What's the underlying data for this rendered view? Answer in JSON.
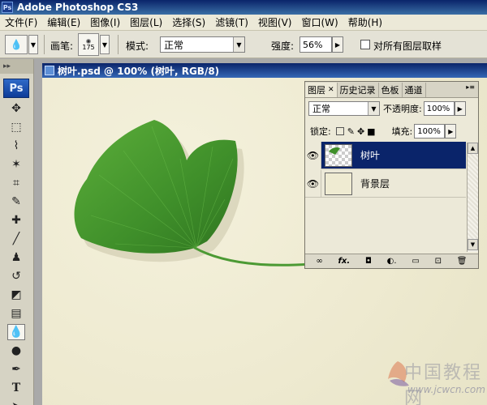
{
  "app": {
    "title": "Adobe Photoshop CS3",
    "logo": "Ps"
  },
  "menu": [
    "文件(F)",
    "编辑(E)",
    "图像(I)",
    "图层(L)",
    "选择(S)",
    "滤镜(T)",
    "视图(V)",
    "窗口(W)",
    "帮助(H)"
  ],
  "options": {
    "brush_label": "画笔:",
    "brush_size": "175",
    "mode_label": "模式:",
    "mode_value": "正常",
    "strength_label": "强度:",
    "strength_value": "56%",
    "sample_all_label": "对所有图层取样"
  },
  "tools": {
    "grip": "▸▸"
  },
  "document": {
    "title": "树叶.psd @ 100% (树叶, RGB/8)"
  },
  "layers_panel": {
    "tabs": [
      "图层",
      "历史记录",
      "色板",
      "通道"
    ],
    "blend_mode": "正常",
    "opacity_label": "不透明度:",
    "opacity_value": "100%",
    "lock_label": "锁定:",
    "fill_label": "填充:",
    "fill_value": "100%",
    "layers": [
      {
        "name": "树叶",
        "active": true
      },
      {
        "name": "背景层",
        "active": false
      }
    ],
    "bottom_icons": [
      "link-icon",
      "fx-icon",
      "mask-icon",
      "adjustment-icon",
      "group-icon",
      "new-layer-icon",
      "trash-icon"
    ],
    "bottom_labels": [
      "∞",
      "fx.",
      "◘",
      "◐.",
      "▭",
      "⊡",
      "🗑"
    ]
  },
  "watermark": {
    "line1": "中国教程网",
    "line2": "www.jcwcn.com"
  },
  "colors": {
    "titlebar": "#0a246a",
    "active_layer": "#0a246a",
    "leaf": "#3f8f2a",
    "canvas": "#efebd2"
  }
}
